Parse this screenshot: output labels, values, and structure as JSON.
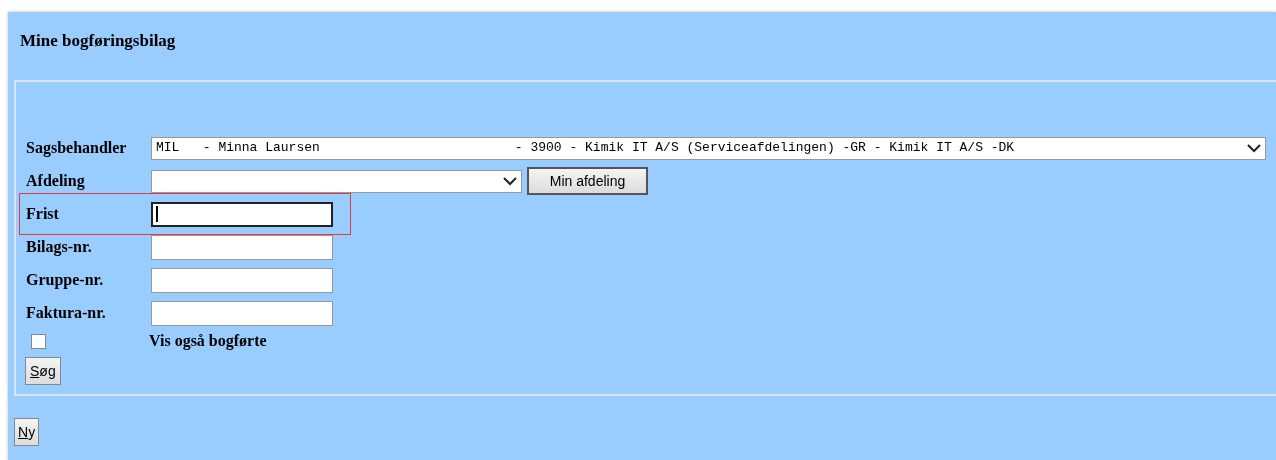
{
  "title": "Mine bogføringsbilag",
  "fields": [
    {
      "label": "Sagsbehandler",
      "kind": "select",
      "value": "MIL   - Minna Laursen                         - 3900 - Kimik IT A/S (Serviceafdelingen) -GR - Kimik IT A/S -DK"
    },
    {
      "label": "Afdeling",
      "kind": "select",
      "button": "Min afdeling"
    },
    {
      "label": "Frist",
      "kind": "text",
      "focused": true,
      "highlighted": true
    },
    {
      "label": "Bilags-nr.",
      "kind": "text",
      "focused": false,
      "highlighted": false
    },
    {
      "label": "Gruppe-nr.",
      "kind": "text",
      "focused": false,
      "highlighted": false
    },
    {
      "label": "Faktura-nr.",
      "kind": "text",
      "focused": false,
      "highlighted": false
    }
  ],
  "checkbox": {
    "label": "Vis også bogførte",
    "checked": false
  },
  "search_button": {
    "label": "Søg",
    "underline_first": true
  },
  "new_button": {
    "label": "Ny",
    "underline_first": true
  }
}
